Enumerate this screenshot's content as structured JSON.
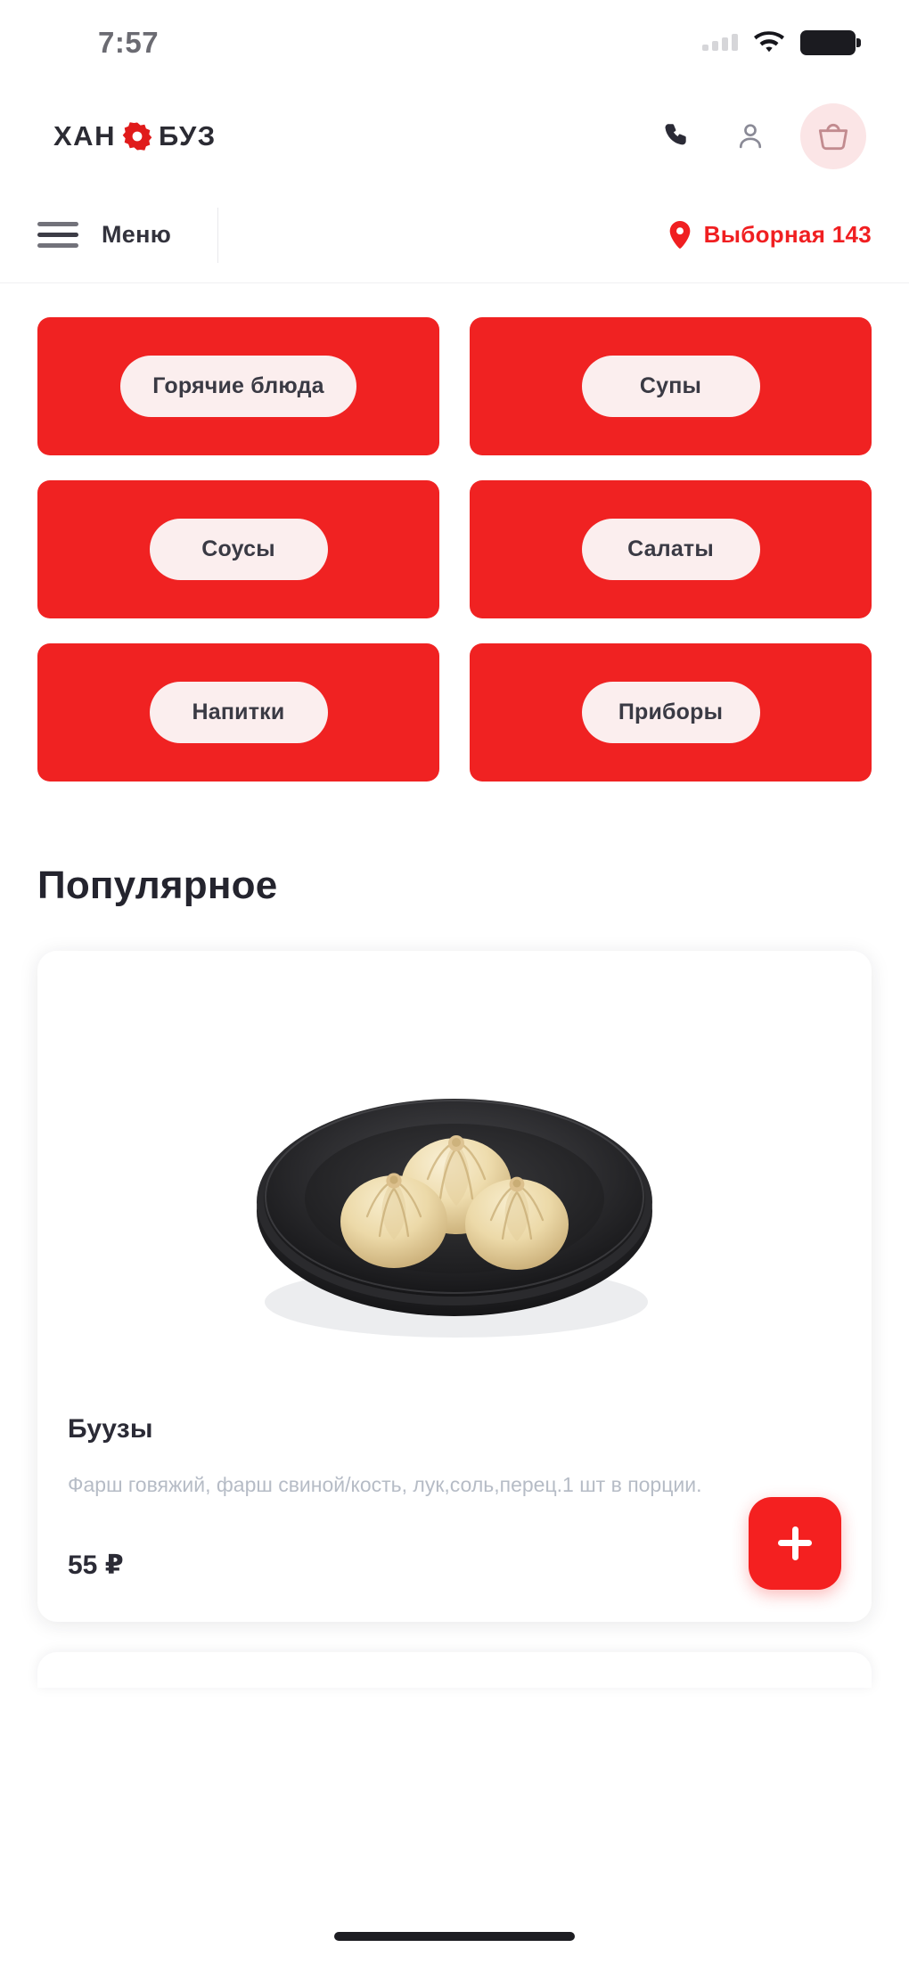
{
  "status_bar": {
    "time": "7:57",
    "signal_icon": "signal-bars-icon",
    "wifi_icon": "wifi-icon",
    "battery_icon": "battery-full-icon"
  },
  "header": {
    "logo_left": "ХАН",
    "logo_right": "БУЗ",
    "logo_badge_icon": "red-flower-badge-icon",
    "actions": [
      {
        "name": "phone-icon",
        "label": "Позвонить"
      },
      {
        "name": "user-icon",
        "label": "Профиль"
      },
      {
        "name": "cart-icon",
        "label": "Корзина"
      }
    ]
  },
  "nav": {
    "menu_label": "Меню",
    "menu_icon": "hamburger-icon",
    "location_icon": "location-pin-icon",
    "location_label": "Выборная 143"
  },
  "categories": [
    {
      "label": "Горячие блюда"
    },
    {
      "label": "Супы"
    },
    {
      "label": "Соусы"
    },
    {
      "label": "Салаты"
    },
    {
      "label": "Напитки"
    },
    {
      "label": "Приборы"
    }
  ],
  "popular": {
    "section_title": "Популярное",
    "items": [
      {
        "name": "Буузы",
        "description": "Фарш говяжий, фарш свиной/кость, лук,соль,перец.1 шт в порции.",
        "price": "55 ₽",
        "image_alt": "buuzy-on-black-plate",
        "add_button_icon": "plus-icon"
      }
    ]
  },
  "colors": {
    "brand_red": "#f02222",
    "accent_red": "#f42020",
    "pill_bg": "#fbeeee",
    "cart_bg": "#fbe5e6",
    "text_dark": "#2b2b36",
    "text_muted": "#b6bcc6"
  },
  "home_indicator": {
    "name": "home-indicator"
  }
}
